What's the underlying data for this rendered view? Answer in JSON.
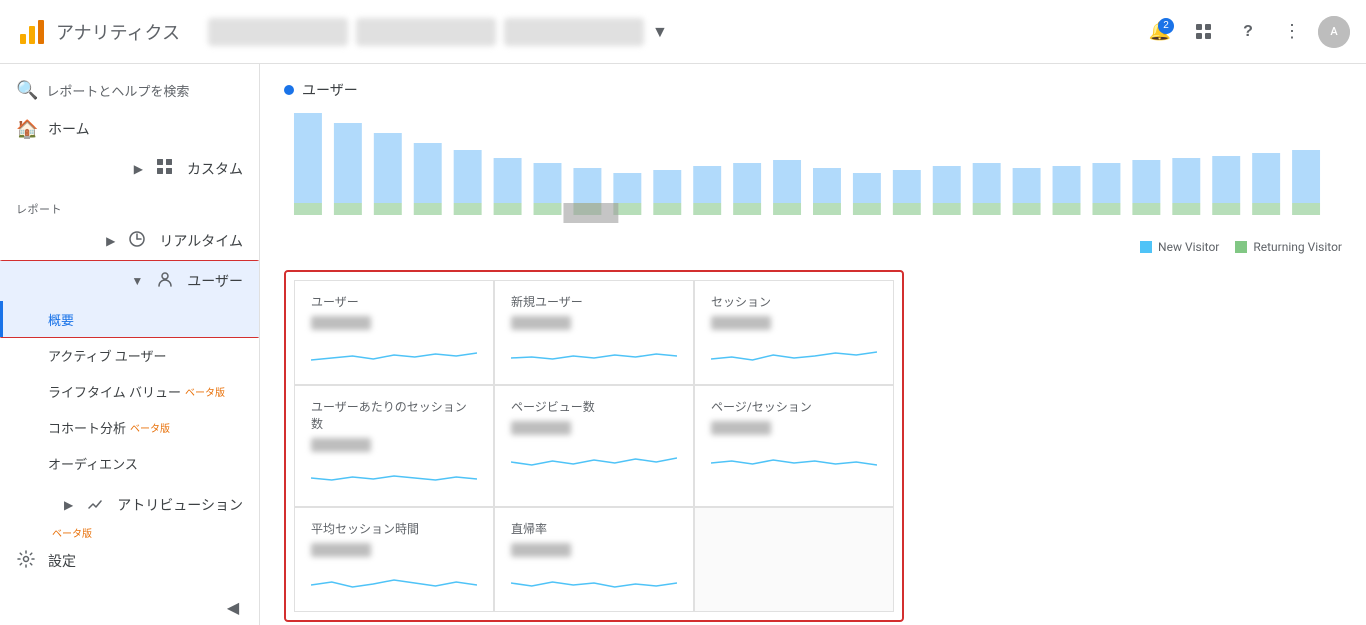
{
  "header": {
    "logo_text": "アナリティクス",
    "account_blurred": "████████████",
    "nav_badge": "2",
    "avatar_initial": "A"
  },
  "sidebar": {
    "search_placeholder": "レポートとヘルプを検索",
    "items": [
      {
        "id": "home",
        "label": "ホーム",
        "icon": "🏠",
        "expandable": false
      },
      {
        "id": "custom",
        "label": "カスタム",
        "icon": "⊞",
        "expandable": true
      }
    ],
    "section_label": "レポート",
    "report_items": [
      {
        "id": "realtime",
        "label": "リアルタイム",
        "icon": "⏱",
        "expandable": true
      },
      {
        "id": "user",
        "label": "ユーザー",
        "icon": "👤",
        "expandable": true,
        "active": true
      }
    ],
    "user_subitems": [
      {
        "id": "overview",
        "label": "概要",
        "active": true
      },
      {
        "id": "active-users",
        "label": "アクティブ ユーザー"
      },
      {
        "id": "lifetime",
        "label": "ライフタイム バリュー",
        "beta": true
      },
      {
        "id": "cohort",
        "label": "コホート分析",
        "beta": true
      },
      {
        "id": "audience",
        "label": "オーディエンス"
      }
    ],
    "bottom_items": [
      {
        "id": "attribution",
        "label": "アトリビューション",
        "icon": "↩",
        "beta": true
      },
      {
        "id": "settings",
        "label": "設定",
        "icon": "⚙"
      }
    ]
  },
  "chart": {
    "legend_label": "ユーザー",
    "legend_new_visitor": "New Visitor",
    "legend_returning_visitor": "Returning Visitor"
  },
  "metrics": [
    {
      "id": "users",
      "title": "ユーザー"
    },
    {
      "id": "new-users",
      "title": "新規ユーザー"
    },
    {
      "id": "sessions",
      "title": "セッション"
    },
    {
      "id": "sessions-per-user",
      "title": "ユーザーあたりのセッション数"
    },
    {
      "id": "pageviews",
      "title": "ページビュー数"
    },
    {
      "id": "pages-per-session",
      "title": "ページ/セッション"
    },
    {
      "id": "avg-session",
      "title": "平均セッション時間"
    },
    {
      "id": "bounce-rate",
      "title": "直帰率"
    }
  ],
  "icons": {
    "search": "🔍",
    "home": "🏠",
    "custom": "⊞",
    "realtime": "⏱",
    "user": "👤",
    "attribution": "↩",
    "settings": "⚙",
    "expand": "▶",
    "collapse": "◀",
    "chevron_down": "▼",
    "bell": "🔔",
    "grid": "⊞",
    "help": "?",
    "more": "⋮"
  }
}
